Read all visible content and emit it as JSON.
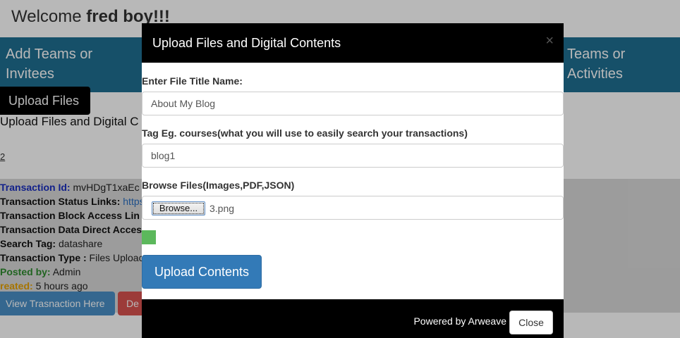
{
  "welcome": {
    "prefix": "Welcome ",
    "user": "fred boy!!!"
  },
  "nav": {
    "left_label": "Add Teams or Invitees",
    "right_label": "Teams or Activities"
  },
  "upload_tab": "Upload Files",
  "background": {
    "heading": "Upload Files and Digital C",
    "count": "2",
    "transaction": [
      {
        "label": "Transaction Id:",
        "value": " mvHDgT1xaEc",
        "label_color": "blue"
      },
      {
        "label": "Transaction Status Links:",
        "value": " https",
        "value_link": true
      },
      {
        "label": "Transaction Block Access Lin",
        "value": ""
      },
      {
        "label": "Transaction Data Direct Acces",
        "value": ""
      },
      {
        "label": "Search Tag:",
        "value": " datashare"
      },
      {
        "label": "Transaction Type :",
        "value": " Files Uploac"
      },
      {
        "label": "Posted by:",
        "value": " Admin",
        "label_color": "green"
      },
      {
        "label": "reated:",
        "value": " 5 hours ago",
        "label_color": "orange"
      }
    ],
    "view_button": "View Trasnaction Here",
    "delete_button": "De"
  },
  "modal": {
    "title": "Upload Files and Digital Contents",
    "close_x": "×",
    "title_label": "Enter File Title Name:",
    "title_value": "About My Blog",
    "tag_label": "Tag Eg. courses(what you will use to easily search your transactions)",
    "tag_value": "blog1",
    "browse_label": "Browse Files(Images,PDF,JSON)",
    "browse_button": "Browse...",
    "file_name": "3.png",
    "progress_fraction": 0.033,
    "upload_button": "Upload Contents",
    "powered_by": "Powered by Arweave",
    "close_button": "Close"
  },
  "colors": {
    "accent_blue": "#337ab7",
    "progress_green": "#5cb85c",
    "teal": "#1f6f92",
    "danger": "#d9534f"
  }
}
